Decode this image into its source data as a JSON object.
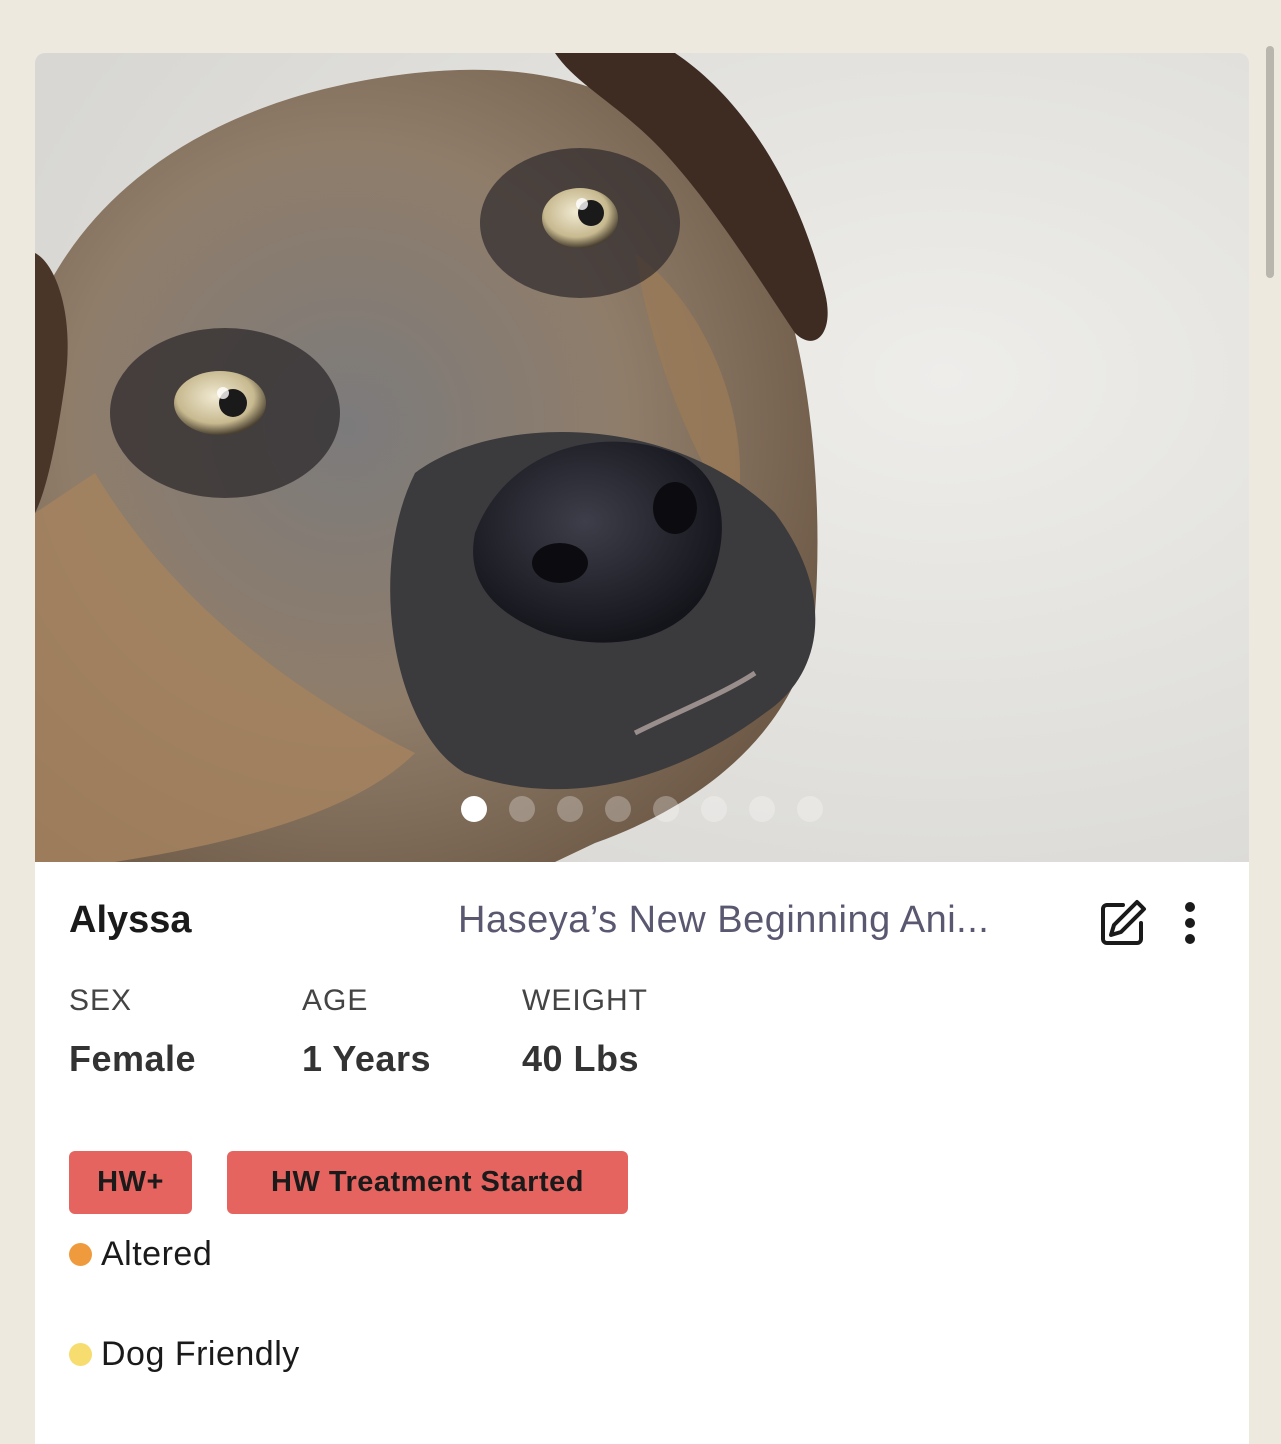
{
  "pet": {
    "name": "Alyssa",
    "organization": "Haseya’s New Beginning Ani..."
  },
  "photo": {
    "description_icon": "dog-photo",
    "dot_count": 8,
    "active_dot": 0
  },
  "stats": [
    {
      "label": "SEX",
      "value": "Female"
    },
    {
      "label": "AGE",
      "value": "1 Years"
    },
    {
      "label": "WEIGHT",
      "value": "40 Lbs"
    }
  ],
  "tags": [
    "HW+",
    "HW Treatment Started"
  ],
  "traits": [
    {
      "label": "Altered",
      "color": "#ef9a3c"
    },
    {
      "label": "Dog Friendly",
      "color": "#f7dc6f"
    }
  ],
  "colors": {
    "background": "#ede9df",
    "tag": "#e66460",
    "org_text": "#5a5870"
  },
  "icons": {
    "edit": "edit-icon",
    "more": "more-vertical-icon"
  }
}
